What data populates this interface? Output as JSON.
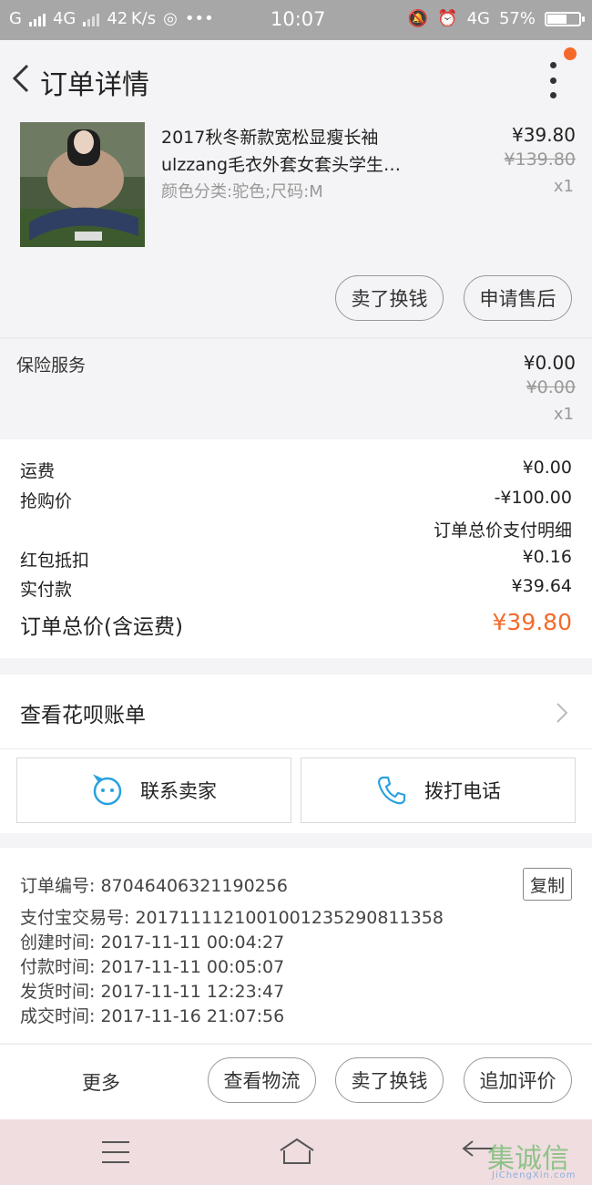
{
  "status_bar": {
    "carrier": "G",
    "network": "4G",
    "speed": "42 K/s",
    "time": "10:07",
    "network_right": "4G",
    "battery": "57%"
  },
  "header": {
    "title": "订单详情"
  },
  "product": {
    "title_line1": "2017秋冬新款宽松显瘦长袖",
    "title_line2": "ulzzang毛衣外套女套头学生…",
    "sku": "颜色分类:驼色;尺码:M",
    "price": "¥39.80",
    "original_price": "¥139.80",
    "quantity": "x1",
    "sell_button": "卖了换钱",
    "after_sale_button": "申请售后"
  },
  "insurance": {
    "label": "保险服务",
    "price": "¥0.00",
    "original_price": "¥0.00",
    "quantity": "x1"
  },
  "summary": {
    "rows": [
      {
        "label": "运费",
        "value": "¥0.00"
      },
      {
        "label": "抢购价",
        "value": "-¥100.00"
      }
    ],
    "detail_title": "订单总价支付明细",
    "redpacket_label": "红包抵扣",
    "redpacket_value": "¥0.16",
    "paid_label": "实付款",
    "paid_value": "¥39.64",
    "total_label": "订单总价(含运费)",
    "total_value": "¥39.80"
  },
  "huabei": {
    "label": "查看花呗账单"
  },
  "contact": {
    "seller_label": "联系卖家",
    "phone_label": "拨打电话"
  },
  "order_info": {
    "order_no": "订单编号: 870464063211902​56",
    "copy_label": "复制",
    "alipay_no": "支付宝交易号: 20171111210010012352908113​58",
    "created": "创建时间: 2017-11-11  00:04:27",
    "paid": "付款时间: 2017-11-11  00:05:07",
    "shipped": "发货时间: 2017-11-11  12:23:47",
    "completed": "成交时间: 2017-11-16  21:07:56"
  },
  "actions": {
    "more": "更多",
    "logistics": "查看物流",
    "sell": "卖了换钱",
    "review": "追加评价"
  },
  "watermark": {
    "brand": "集诚信",
    "site": "JiChengXin.com"
  },
  "colors": {
    "accent": "#f4692a",
    "blue_icon": "#2aa1e0"
  }
}
